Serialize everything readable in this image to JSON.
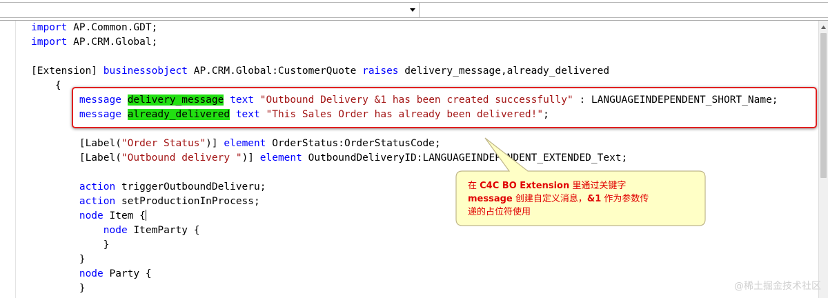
{
  "editor": {
    "lines": [
      [
        {
          "t": "import",
          "c": "kw"
        },
        {
          "t": " AP.Common.GDT;"
        }
      ],
      [
        {
          "t": "import",
          "c": "kw"
        },
        {
          "t": " AP.CRM.Global;"
        }
      ],
      [
        {
          "t": ""
        }
      ],
      [
        {
          "t": "[Extension] "
        },
        {
          "t": "businessobject",
          "c": "kw"
        },
        {
          "t": " AP.CRM.Global:CustomerQuote "
        },
        {
          "t": "raises",
          "c": "kw"
        },
        {
          "t": " delivery_message,already_delivered"
        }
      ],
      [
        {
          "t": "    {"
        }
      ],
      [
        {
          "t": "        "
        },
        {
          "t": "message",
          "c": "kw"
        },
        {
          "t": " "
        },
        {
          "t": "delivery_message",
          "c": "hl"
        },
        {
          "t": " "
        },
        {
          "t": "text",
          "c": "kw"
        },
        {
          "t": " "
        },
        {
          "t": "\"Outbound Delivery &1 has been created successfully\"",
          "c": "str"
        },
        {
          "t": " : LANGUAGEINDEPENDENT_SHORT_Name;"
        }
      ],
      [
        {
          "t": "        "
        },
        {
          "t": "message",
          "c": "kw"
        },
        {
          "t": " "
        },
        {
          "t": "already_delivered",
          "c": "hl"
        },
        {
          "t": " "
        },
        {
          "t": "text",
          "c": "kw"
        },
        {
          "t": " "
        },
        {
          "t": "\"This Sales Order has already been delivered!\"",
          "c": "str"
        },
        {
          "t": ";"
        }
      ],
      [
        {
          "t": ""
        }
      ],
      [
        {
          "t": "        [Label("
        },
        {
          "t": "\"Order Status\"",
          "c": "str"
        },
        {
          "t": ")] "
        },
        {
          "t": "element",
          "c": "kw"
        },
        {
          "t": " OrderStatus:OrderStatusCode;"
        }
      ],
      [
        {
          "t": "        [Label("
        },
        {
          "t": "\"Outbound delivery \"",
          "c": "str"
        },
        {
          "t": ")] "
        },
        {
          "t": "element",
          "c": "kw"
        },
        {
          "t": " OutboundDeliveryID:LANGUAGEINDEPENDENT_EXTENDED_Text;"
        }
      ],
      [
        {
          "t": ""
        }
      ],
      [
        {
          "t": "        "
        },
        {
          "t": "action",
          "c": "kw"
        },
        {
          "t": " triggerOutboundDeliveru;"
        }
      ],
      [
        {
          "t": "        "
        },
        {
          "t": "action",
          "c": "kw"
        },
        {
          "t": " setProductionInProcess;"
        }
      ],
      [
        {
          "t": "        "
        },
        {
          "t": "node",
          "c": "kw"
        },
        {
          "t": " Item {"
        },
        {
          "t": "",
          "c": "caret"
        }
      ],
      [
        {
          "t": "            "
        },
        {
          "t": "node",
          "c": "kw"
        },
        {
          "t": " ItemParty {"
        }
      ],
      [
        {
          "t": "            }"
        }
      ],
      [
        {
          "t": "        }"
        }
      ],
      [
        {
          "t": "        "
        },
        {
          "t": "node",
          "c": "kw"
        },
        {
          "t": " Party {"
        }
      ],
      [
        {
          "t": "        }"
        }
      ]
    ]
  },
  "callout": {
    "parts": [
      {
        "t": "在 ",
        "b": false
      },
      {
        "t": "C4C BO Extension",
        "b": true
      },
      {
        "t": " 里通过关键字",
        "b": false
      },
      {
        "t": "\n",
        "b": false
      },
      {
        "t": "message",
        "b": true
      },
      {
        "t": " 创建自定义消息，",
        "b": false
      },
      {
        "t": "&1",
        "b": true
      },
      {
        "t": " 作为参数传",
        "b": false
      },
      {
        "t": "\n",
        "b": false
      },
      {
        "t": "递的占位符使用",
        "b": false
      }
    ]
  },
  "watermark": "@稀土掘金技术社区",
  "colors": {
    "keyword": "#0000ff",
    "string": "#a31515",
    "highlight": "#22e012",
    "callout_fill": "#ffffc6",
    "callout_border": "#bfb68a",
    "callout_text": "#e00000",
    "annotation_box": "#e02020"
  }
}
